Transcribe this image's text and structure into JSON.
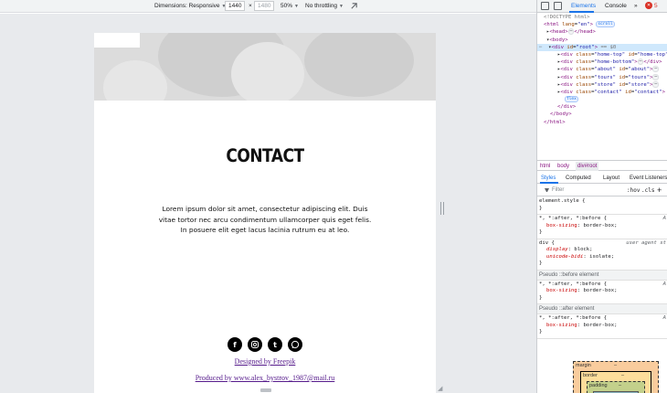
{
  "toolbar": {
    "dimensions_label": "Dimensions: Responsive",
    "width_value": "1440",
    "times": "×",
    "height_value": "1480",
    "zoom": "50%",
    "throttling": "No throttling"
  },
  "page": {
    "title": "CONTACT",
    "text": "Lorem ipsum dolor sit amet, consectetur adipiscing elit. Duis vitae tortor nec arcu condimentum ullamcorper quis eget felis. In posuere elit eget lacus lacinia rutrum eu at leo.",
    "socials": [
      {
        "name": "facebook-icon",
        "glyph": "f"
      },
      {
        "name": "instagram-icon",
        "glyph": ""
      },
      {
        "name": "tumblr-icon",
        "glyph": "t"
      },
      {
        "name": "whatsapp-icon",
        "glyph": ""
      }
    ],
    "designed_by": "Designed by Freepik",
    "produced_by": "Produced by www.alex_bystrov_1987@mail.ru"
  },
  "devtools": {
    "tabs": {
      "elements": "Elements",
      "console": "Console",
      "more": "»",
      "error_count": "5",
      "error_glyph": "✕"
    },
    "dom": {
      "doctype": "<!DOCTYPE html>",
      "html_open": "<html",
      "html_attr": "lang",
      "html_val": "\"en\"",
      "scroll_pill": "scroll",
      "head": "<head>",
      "head_close": "</head>",
      "body_open": "<body>",
      "root_open": "<div",
      "root_attr": "id",
      "root_val": "\"root\"",
      "root_eq": "== $0",
      "children": [
        {
          "cls": "\"home-top\"",
          "id": "\"home-top\""
        },
        {
          "cls": "\"home-bottom\"",
          "id": ""
        },
        {
          "cls": "\"about\"",
          "id": "\"about\""
        },
        {
          "cls": "\"tours\"",
          "id": "\"tours\""
        },
        {
          "cls": "\"store\"",
          "id": "\"store\""
        },
        {
          "cls": "\"contact\"",
          "id": "\"contact\""
        }
      ],
      "flex_pill": "flex",
      "div_close": "</div>",
      "body_close": "</body>",
      "html_close": "</html>"
    },
    "breadcrumbs": [
      "html",
      "body",
      "div#root"
    ],
    "style_tabs": [
      "Styles",
      "Computed",
      "Layout",
      "Event Listeners"
    ],
    "filter_placeholder": "Filter",
    "hov": ":hov",
    "cls": ".cls",
    "plus": "+",
    "rules": {
      "element_style": "element.style {",
      "close_brace": "}",
      "universal_selector": "*, *:after, *:before {",
      "box_sizing_prop": "box-sizing",
      "box_sizing_val": "border-box;",
      "source_a": "A",
      "div_selector": "div {",
      "user_agent": "user agent st",
      "display_prop": "display",
      "display_val": "block;",
      "unicode_prop": "unicode-bidi",
      "unicode_val": "isolate;",
      "pseudo_before": "Pseudo ::before element",
      "pseudo_after": "Pseudo ::after element"
    },
    "box_model": {
      "margin": "margin",
      "border": "border",
      "padding": "padding",
      "dash": "–"
    }
  }
}
